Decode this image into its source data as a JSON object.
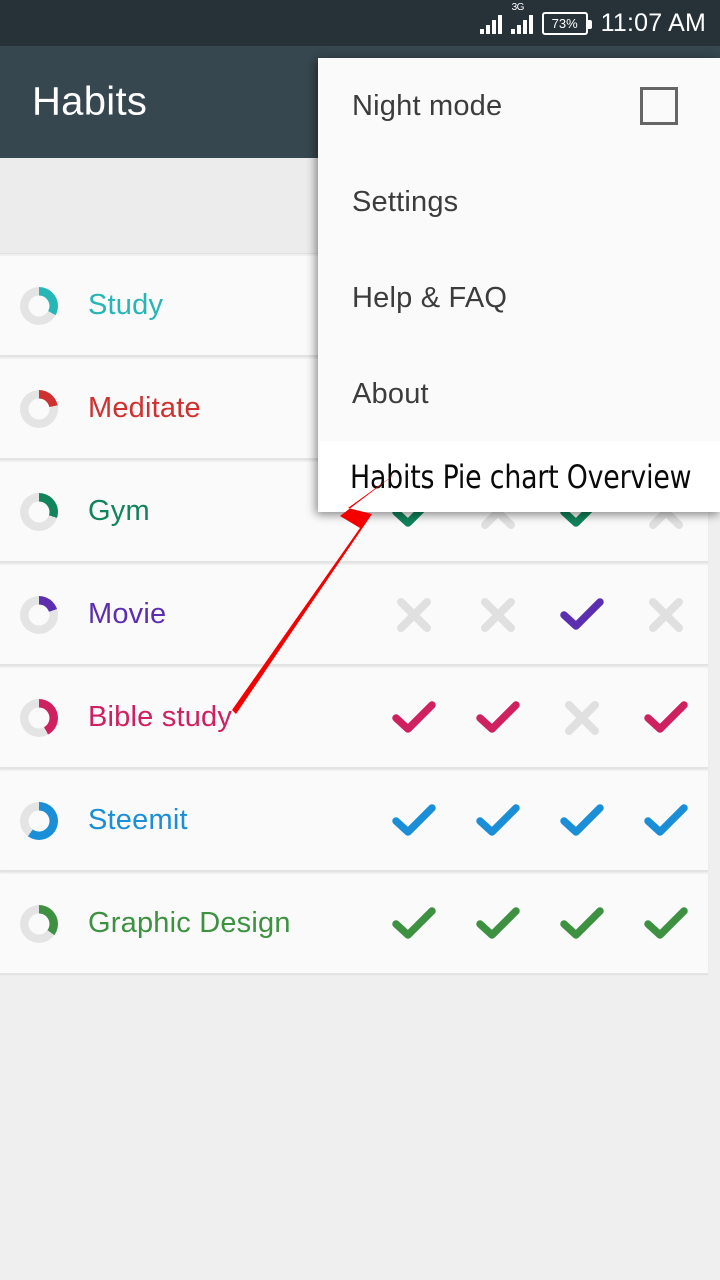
{
  "statusbar": {
    "signal1_icon": "signal-bars-icon",
    "signal2_icon": "signal-bars-3g-icon",
    "network_label": "3G",
    "battery_icon": "battery-icon",
    "battery_level": "73%",
    "clock": "11:07 AM"
  },
  "appbar": {
    "title": "Habits",
    "background": "#37474f"
  },
  "menu": {
    "items": [
      {
        "label": "Night mode",
        "has_checkbox": true,
        "checked": false
      },
      {
        "label": "Settings",
        "has_checkbox": false
      },
      {
        "label": "Help & FAQ",
        "has_checkbox": false
      },
      {
        "label": "About",
        "has_checkbox": false
      }
    ]
  },
  "annotation": {
    "text": "Habits Pie chart Overview",
    "arrow_color": "#f40000"
  },
  "habits": [
    {
      "name": "Study",
      "color": "#26b6b6",
      "progress": 0.33,
      "marks": [
        "none",
        "none",
        "none",
        "none"
      ]
    },
    {
      "name": "Meditate",
      "color": "#cf3030",
      "progress": 0.22,
      "marks": [
        "none",
        "none",
        "none",
        "none"
      ]
    },
    {
      "name": "Gym",
      "color": "#11845c",
      "progress": 0.3,
      "marks": [
        "check",
        "cross",
        "check",
        "cross"
      ]
    },
    {
      "name": "Movie",
      "color": "#5b2fb0",
      "progress": 0.2,
      "marks": [
        "cross",
        "cross",
        "check",
        "cross"
      ]
    },
    {
      "name": "Bible study",
      "color": "#cf2060",
      "progress": 0.42,
      "marks": [
        "check",
        "check",
        "cross",
        "check"
      ]
    },
    {
      "name": "Steemit",
      "color": "#1a8fd8",
      "progress": 0.6,
      "marks": [
        "check",
        "check",
        "check",
        "check"
      ]
    },
    {
      "name": "Graphic Design",
      "color": "#3d9141",
      "progress": 0.35,
      "marks": [
        "check",
        "check",
        "check",
        "check"
      ]
    }
  ],
  "colors": {
    "cross_grey": "#e0e0e0",
    "ring_track": "#e4e4e4",
    "row_bg": "#fafafa",
    "page_bg": "#efefef"
  }
}
